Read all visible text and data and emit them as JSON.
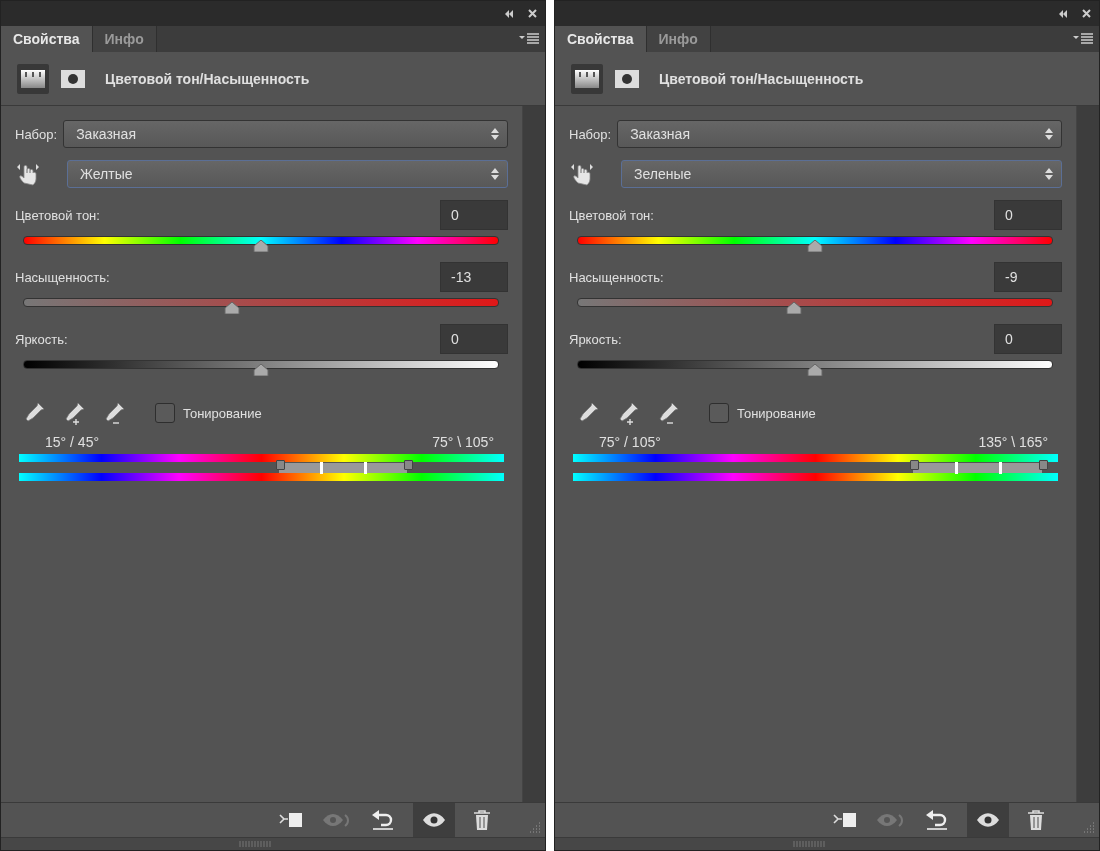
{
  "panels": [
    {
      "tabs": [
        {
          "label": "Свойства",
          "selected": true
        },
        {
          "label": "Инфо",
          "selected": false
        }
      ],
      "title": "Цветовой тон/Насыщенность",
      "preset": {
        "label": "Набор:",
        "value": "Заказная"
      },
      "channel": {
        "value": "Желтые"
      },
      "sliders": [
        {
          "kind": "hue",
          "label": "Цветовой тон:",
          "value": "0",
          "level": 0.5
        },
        {
          "kind": "saturation",
          "label": "Насыщенность:",
          "value": "-13",
          "level": 0.44
        },
        {
          "kind": "lightness",
          "label": "Яркость:",
          "value": "0",
          "level": 0.5
        }
      ],
      "colorize": {
        "label": "Тонирование",
        "checked": false
      },
      "range_labels": [
        "15° / 45°",
        "75° \\ 105°"
      ],
      "range_handles": [
        {
          "level": 0.536
        },
        {
          "level": 0.622
        },
        {
          "level": 0.713
        },
        {
          "level": 0.8
        }
      ]
    },
    {
      "tabs": [
        {
          "label": "Свойства",
          "selected": true
        },
        {
          "label": "Инфо",
          "selected": false
        }
      ],
      "title": "Цветовой тон/Насыщенность",
      "preset": {
        "label": "Набор:",
        "value": "Заказная"
      },
      "channel": {
        "value": "Зеленые"
      },
      "sliders": [
        {
          "kind": "hue",
          "label": "Цветовой тон:",
          "value": "0",
          "level": 0.5
        },
        {
          "kind": "saturation",
          "label": "Насыщенность:",
          "value": "-9",
          "level": 0.456
        },
        {
          "kind": "lightness",
          "label": "Яркость:",
          "value": "0",
          "level": 0.5
        }
      ],
      "colorize": {
        "label": "Тонирование",
        "checked": false
      },
      "range_labels": [
        "75° / 105°",
        "135° \\ 165°"
      ],
      "range_handles": [
        {
          "level": 0.7
        },
        {
          "level": 0.79
        },
        {
          "level": 0.88
        },
        {
          "level": 0.967
        }
      ]
    }
  ]
}
